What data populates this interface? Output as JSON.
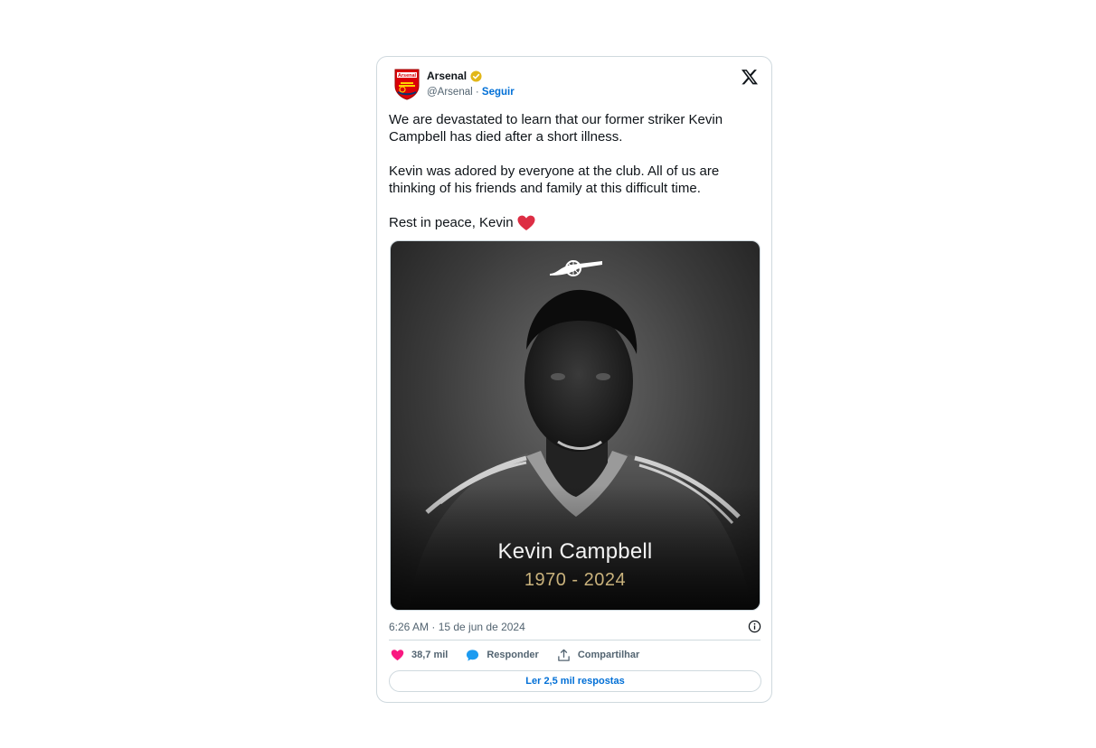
{
  "account": {
    "display_name": "Arsenal",
    "handle": "@Arsenal",
    "separator": "·",
    "follow_label": "Seguir"
  },
  "tweet": {
    "paragraph_1": "We are devastated to learn that our former striker Kevin Campbell has died after a short illness.",
    "paragraph_2": "Kevin was adored by everyone at the club. All of us are thinking of his friends and family at this difficult time.",
    "paragraph_3": "Rest in peace, Kevin"
  },
  "media": {
    "name": "Kevin Campbell",
    "years": "1970 - 2024"
  },
  "meta": {
    "timestamp": "6:26 AM · 15 de jun de 2024"
  },
  "actions": {
    "likes": "38,7 mil",
    "reply_label": "Responder",
    "share_label": "Compartilhar"
  },
  "replies_button": "Ler 2,5 mil respostas",
  "icons": {
    "avatar": "arsenal-crest-icon",
    "verified": "gold-verified-badge-icon",
    "platform": "x-logo-icon",
    "heart_emoji": "red-heart-icon",
    "info": "info-icon",
    "like": "heart-icon",
    "reply": "speech-bubble-icon",
    "share": "share-icon"
  },
  "colors": {
    "link": "#006fd6",
    "like": "#f91880",
    "reply": "#1d9bf0",
    "verified": "#e2b719",
    "years_gold": "#c9b27c",
    "text_secondary": "#536471"
  }
}
